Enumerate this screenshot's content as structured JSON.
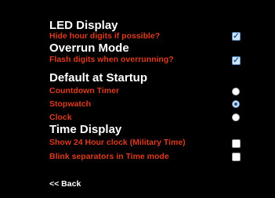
{
  "sections": {
    "led_display": {
      "title": "LED Display",
      "hide_hour_digits": {
        "label": "Hide hour digits if possible?",
        "checked": true
      }
    },
    "overrun_mode": {
      "title": "Overrun Mode",
      "flash_digits": {
        "label": "Flash digits when overrunning?",
        "checked": true
      }
    },
    "default_at_startup": {
      "title": "Default at Startup",
      "options": [
        {
          "label": "Countdown Timer",
          "selected": false
        },
        {
          "label": "Stopwatch",
          "selected": true
        },
        {
          "label": "Clock",
          "selected": false
        }
      ]
    },
    "time_display": {
      "title": "Time Display",
      "show_24_hour": {
        "label": "Show 24 Hour clock (Military Time)",
        "checked": false
      },
      "blink_separators": {
        "label": "Blink separators in Time mode",
        "checked": false
      }
    }
  },
  "back_link": {
    "label": "<< Back"
  },
  "colors": {
    "background": "#000000",
    "heading": "#ffffff",
    "option_text": "#e03a1e",
    "accent": "#1f4d86"
  }
}
